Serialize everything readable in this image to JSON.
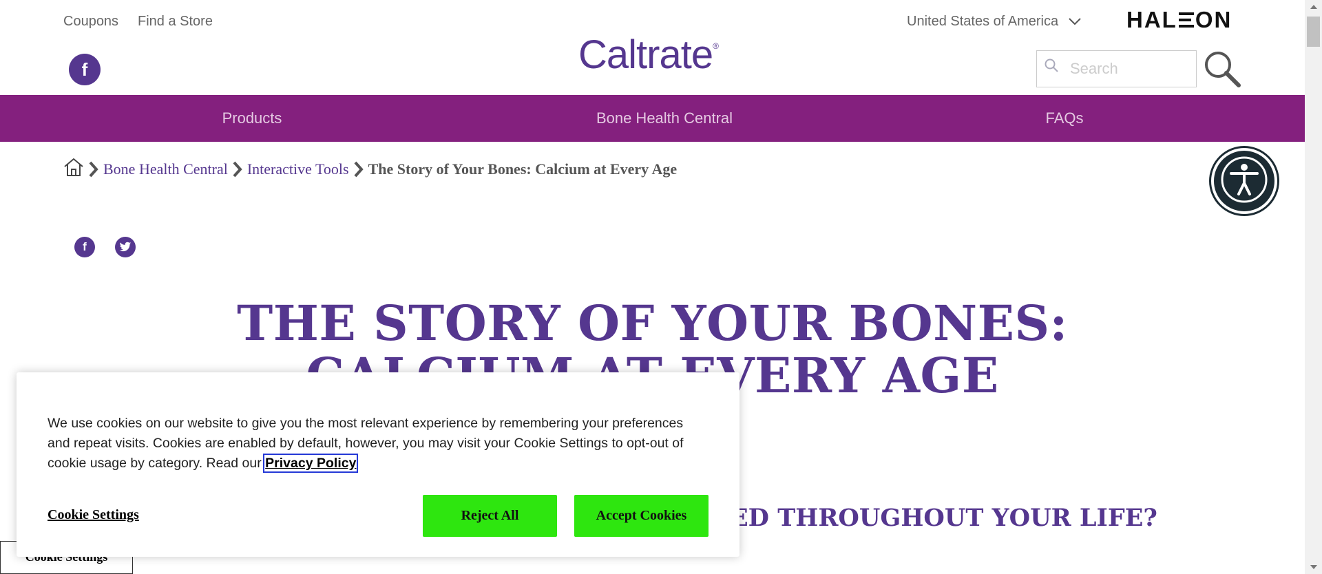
{
  "utility": {
    "coupons": "Coupons",
    "find_store": "Find a Store",
    "country": "United States of America",
    "brand": "HALEON"
  },
  "logo": {
    "text": "Caltrate",
    "mark": "®"
  },
  "search": {
    "placeholder": "Search"
  },
  "nav": {
    "items": [
      {
        "label": "Products"
      },
      {
        "label": "Bone Health Central"
      },
      {
        "label": "FAQs"
      }
    ]
  },
  "breadcrumb": {
    "items": [
      {
        "label": "Bone Health Central"
      },
      {
        "label": "Interactive Tools"
      }
    ],
    "current": "The Story of Your Bones: Calcium at Every Age"
  },
  "main": {
    "title": "THE STORY OF YOUR BONES: CALCIUM AT EVERY AGE",
    "subheading": "ED THROUGHOUT YOUR LIFE?"
  },
  "cookie": {
    "text": "We use cookies on our website to give you the most relevant experience by remembering your preferences and repeat visits. Cookies are enabled by default, however, you may visit your Cookie Settings to opt-out of cookie usage by category. Read our",
    "privacy_link": "Privacy Policy",
    "settings_label": "Cookie Settings",
    "reject_label": "Reject All",
    "accept_label": "Accept Cookies"
  },
  "floating_cookie_settings": "Cookie Settings",
  "colors": {
    "brand_purple": "#55378f",
    "nav_magenta": "#84207e",
    "accept_green": "#2ee60f",
    "a11y_dark": "#1c2b33"
  }
}
